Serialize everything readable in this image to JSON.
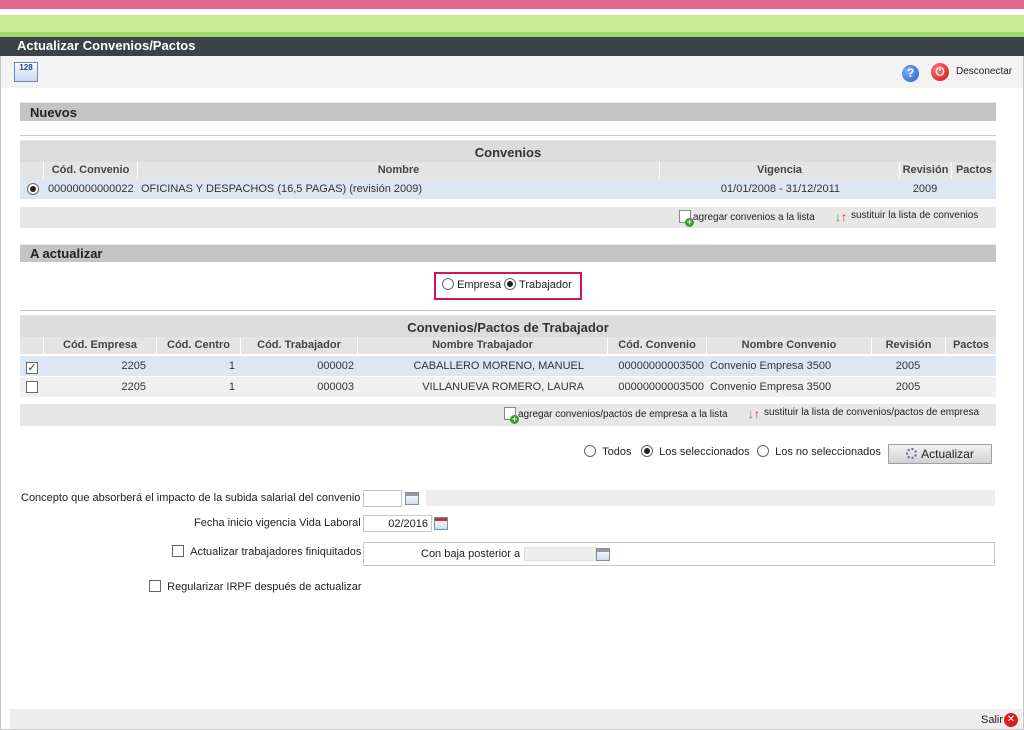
{
  "window": {
    "title": "Actualizar Convenios/Pactos"
  },
  "toolbar": {
    "calc_icon_text": "128",
    "help_glyph": "?",
    "power_glyph": "⏻",
    "disconnect_label": "Desconectar"
  },
  "nuevos": {
    "section_title": "Nuevos",
    "table_title": "Convenios",
    "columns": [
      "Cód. Convenio",
      "Nombre",
      "Vigencia",
      "Revisión",
      "Pactos"
    ],
    "rows": [
      {
        "selected": true,
        "codigo": "00000000000022",
        "nombre": "OFICINAS Y DESPACHOS (16,5 PAGAS) (revisión 2009)",
        "vigencia": "01/01/2008 - 31/12/2011",
        "revision": "2009",
        "pactos": ""
      }
    ],
    "actions": {
      "add": "agregar convenios a la lista",
      "replace": "sustituir la lista de convenios"
    }
  },
  "a_actualizar": {
    "section_title": "A actualizar",
    "mode_options": [
      {
        "label": "Empresa",
        "checked": false
      },
      {
        "label": "Trabajador",
        "checked": true
      }
    ],
    "table_title": "Convenios/Pactos de Trabajador",
    "columns": [
      "Cód. Empresa",
      "Cód. Centro",
      "Cód. Trabajador",
      "Nombre Trabajador",
      "Cód. Convenio",
      "Nombre Convenio",
      "Revisión",
      "Pactos"
    ],
    "rows": [
      {
        "checked": true,
        "empresa": "2205",
        "centro": "1",
        "trabajador": "000002",
        "nombre": "CABALLERO MORENO, MANUEL",
        "convenio": "00000000003500",
        "nombre_convenio": "Convenio Empresa 3500",
        "revision": "2005",
        "pactos": ""
      },
      {
        "checked": false,
        "empresa": "2205",
        "centro": "1",
        "trabajador": "000003",
        "nombre": "VILLANUEVA ROMERO, LAURA",
        "convenio": "00000000003500",
        "nombre_convenio": "Convenio Empresa 3500",
        "revision": "2005",
        "pactos": ""
      }
    ],
    "actions": {
      "add": "agregar convenios/pactos de empresa a la lista",
      "replace": "sustituir la lista de convenios/pactos de empresa"
    },
    "filter": {
      "todos": "Todos",
      "seleccionados": "Los seleccionados",
      "no_seleccionados": "Los no seleccionados",
      "selected": "seleccionados"
    },
    "update_button": "Actualizar"
  },
  "form": {
    "concepto_label": "Concepto que absorberá el impacto de la subida salarial del convenio",
    "concepto_value": "",
    "fecha_label": "Fecha inicio vigencia Vida Laboral",
    "fecha_value": "02/2016",
    "finiquitados_label": "Actualizar trabajadores finiquitados",
    "finiquitados_checked": false,
    "baja_label": "Con baja posterior a",
    "baja_value": "",
    "irpf_label": "Regularizar IRPF después de actualizar",
    "irpf_checked": false
  },
  "footer": {
    "salir": "Salir",
    "salir_glyph": "✕"
  },
  "colors": {
    "pink": "#e0668f",
    "green_light": "#c8eb97",
    "green": "#9fd96a",
    "title_bg": "#3b4248",
    "highlight": "#d4145a",
    "row_selected": "#dde7f3"
  }
}
